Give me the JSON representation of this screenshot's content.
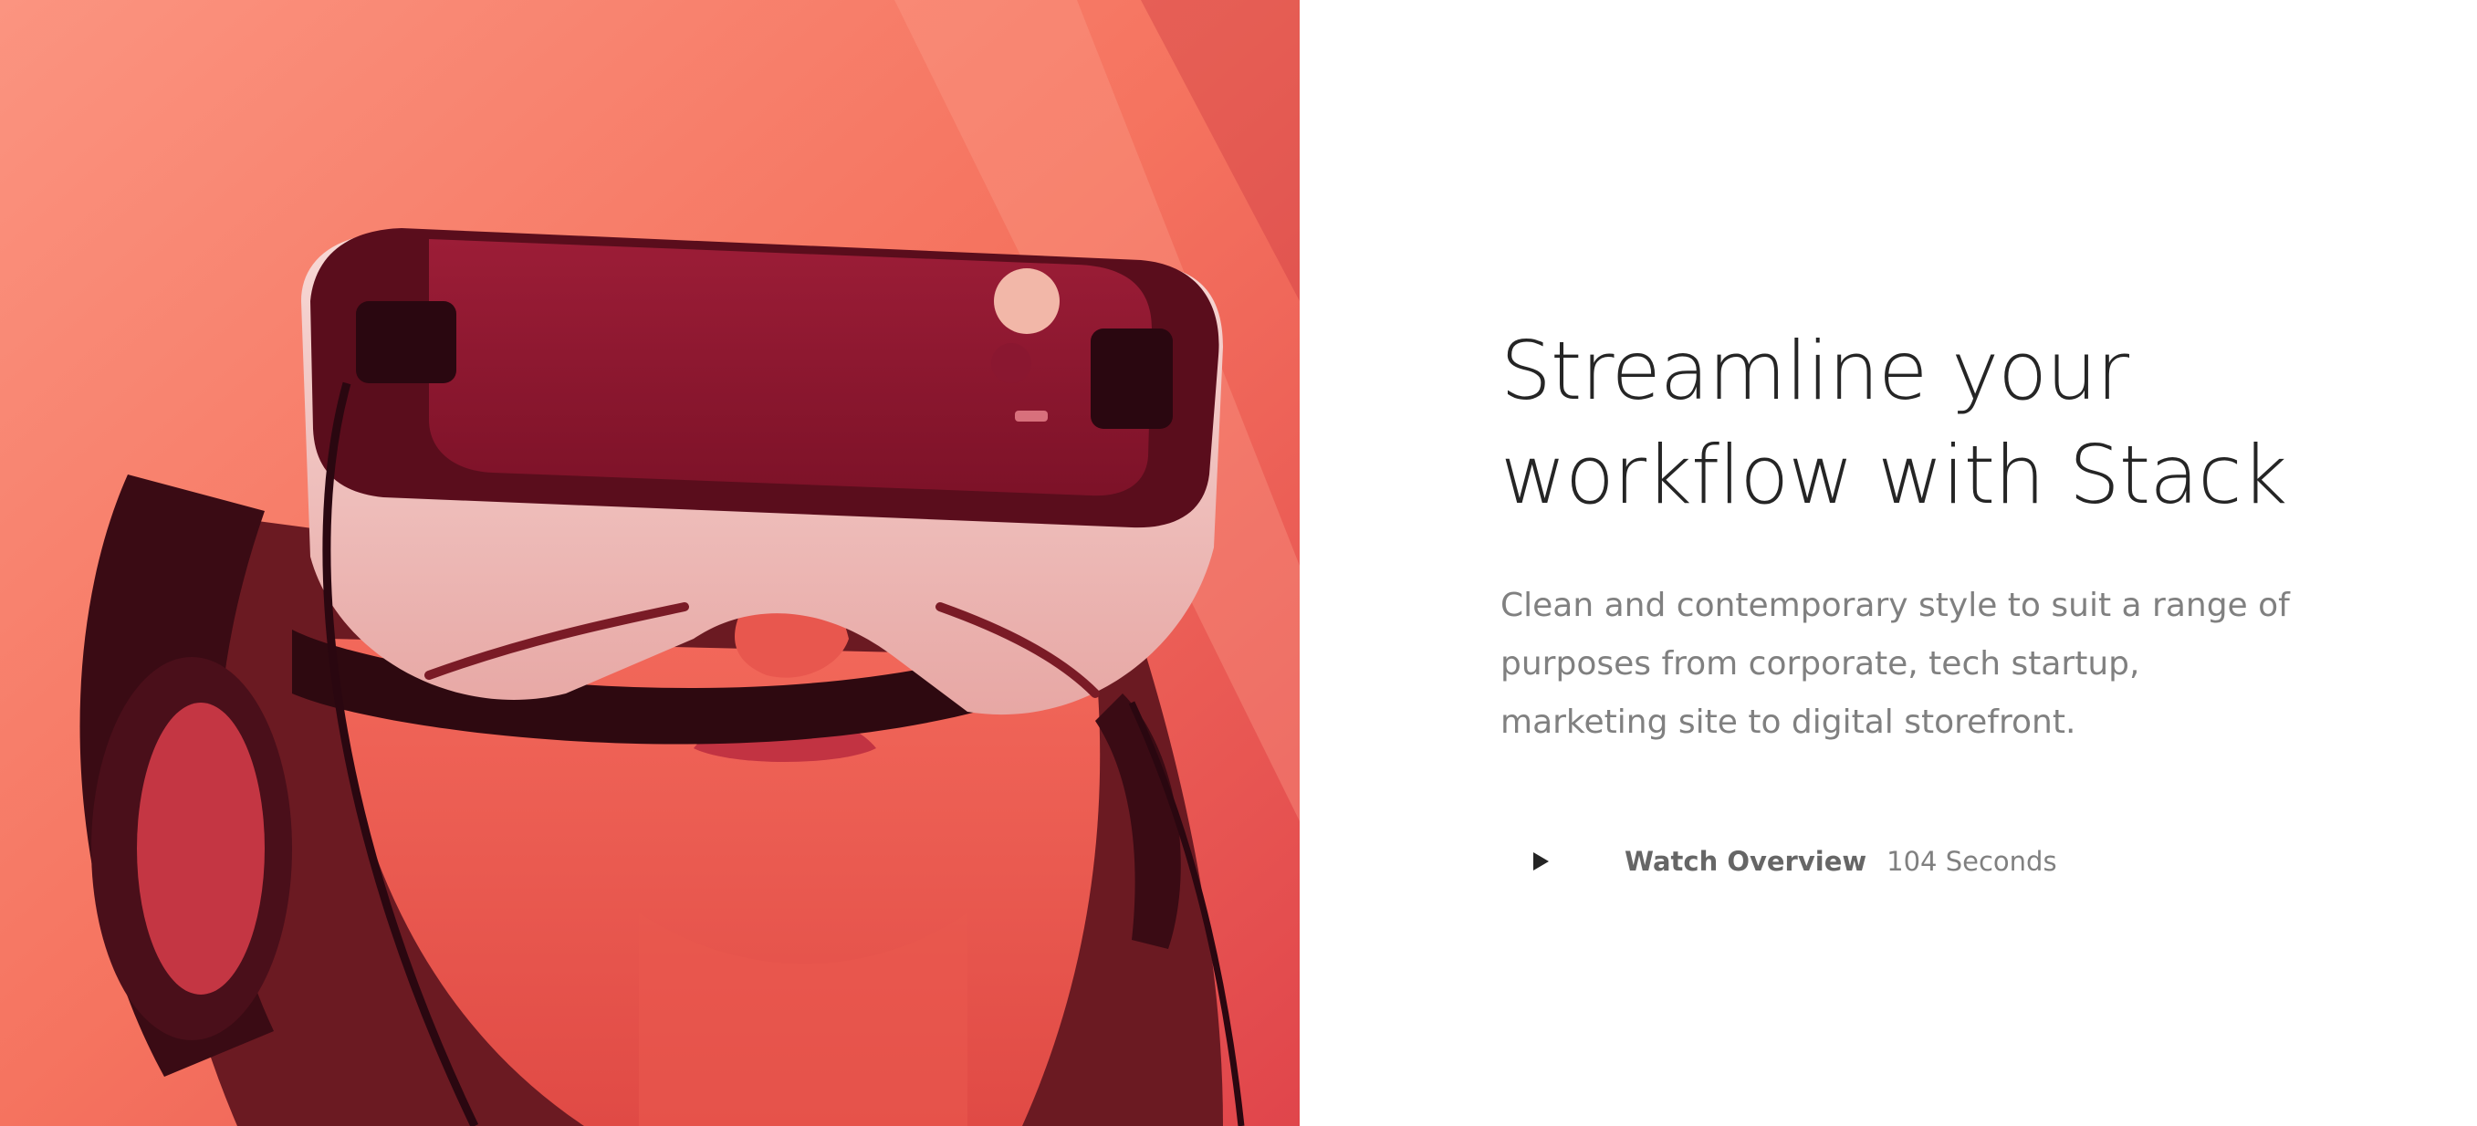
{
  "hero": {
    "image_icon": "vr-headset-photo-icon",
    "image_alt_tint": "#f5705f"
  },
  "content": {
    "headline": "Streamline your\nworkflow with Stack",
    "lead": "Clean and contemporary style to suit a range of purposes from corporate, tech startup, marketing site to digital storefront.",
    "video": {
      "play_icon": "play-icon",
      "label": "Watch Overview",
      "duration": "104 Seconds"
    }
  },
  "colors": {
    "headline": "#252525",
    "body_text": "#808080",
    "cta_label": "#666666",
    "background": "#ffffff"
  }
}
